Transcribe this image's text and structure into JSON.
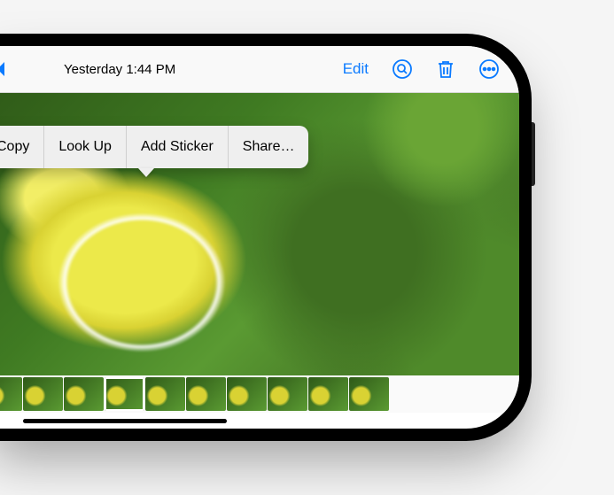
{
  "navbar": {
    "timestamp": "Yesterday  1:44 PM",
    "edit_label": "Edit"
  },
  "context_menu": {
    "items": [
      "Copy",
      "Look Up",
      "Add Sticker",
      "Share…"
    ]
  },
  "thumbnails": {
    "count": 10,
    "current_index": 3
  }
}
